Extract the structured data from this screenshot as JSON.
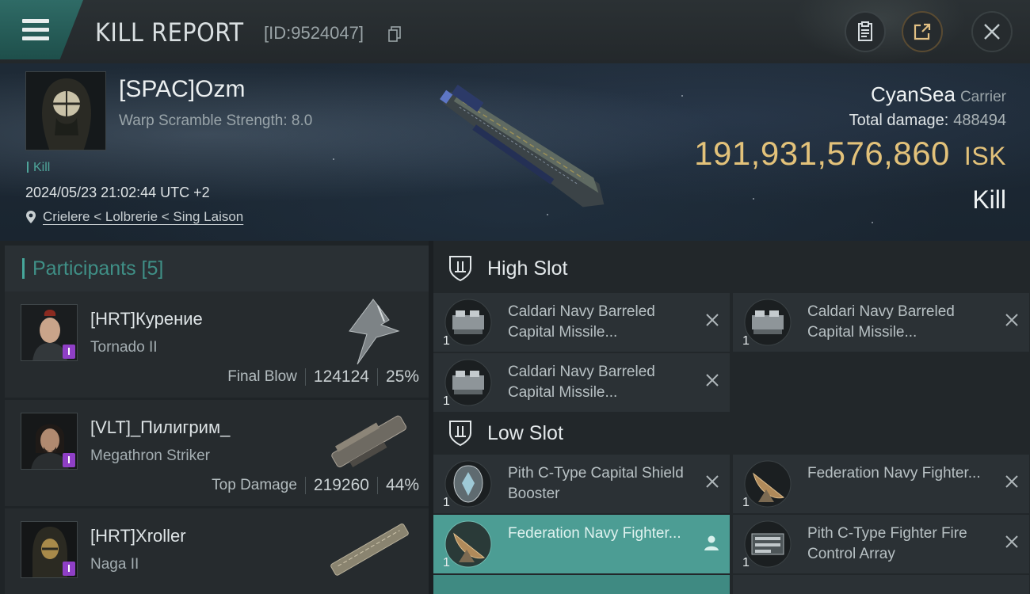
{
  "header": {
    "title": "KILL REPORT",
    "report_id": "[ID:9524047]"
  },
  "victim": {
    "name": "[SPAC]Ozm",
    "warp_scramble": "Warp Scramble Strength: 8.0",
    "kill_tag": "Kill",
    "datetime": "2024/05/23 21:02:44 UTC +2",
    "location": "Crielere < Lolbrerie < Sing Laison",
    "ship_name": "CyanSea",
    "ship_class": "Carrier",
    "total_damage_label": "Total damage:",
    "total_damage_value": "488494",
    "isk_value": "191,931,576,860",
    "isk_unit": "ISK",
    "result_label": "Kill"
  },
  "participants": {
    "header": "Participants [5]",
    "rows": [
      {
        "name": "[HRT]Курение",
        "ship": "Tornado II",
        "role": "Final Blow",
        "damage": "124124",
        "percent": "25%"
      },
      {
        "name": "[VLT]_Пилигрим_",
        "ship": "Megathron Striker",
        "role": "Top Damage",
        "damage": "219260",
        "percent": "44%"
      },
      {
        "name": "[HRT]Xroller",
        "ship": "Naga II"
      }
    ]
  },
  "fitting": {
    "high_slot_label": "High Slot",
    "low_slot_label": "Low Slot",
    "high_modules": [
      {
        "qty": "1",
        "name": "Caldari Navy Barreled Capital Missile..."
      },
      {
        "qty": "1",
        "name": "Caldari Navy Barreled Capital Missile..."
      },
      {
        "qty": "1",
        "name": "Caldari Navy Barreled Capital Missile..."
      }
    ],
    "low_modules": [
      {
        "qty": "1",
        "name": "Pith C-Type Capital Shield Booster"
      },
      {
        "qty": "1",
        "name": "Federation Navy Fighter..."
      },
      {
        "qty": "1",
        "name": "Federation Navy Fighter..."
      },
      {
        "qty": "1",
        "name": "Pith C-Type Fighter Fire Control Array"
      }
    ]
  },
  "colors": {
    "accent_teal": "#46a79b",
    "isk_gold": "#e3c27a",
    "highlight_module": "#4c9d94",
    "badge_purple": "#8f3fc6"
  },
  "icons": [
    "menu-icon",
    "copy-icon",
    "clipboard-icon",
    "share-icon",
    "close-icon",
    "pin-icon",
    "slot-shield-icon",
    "remove-icon",
    "user-icon"
  ]
}
